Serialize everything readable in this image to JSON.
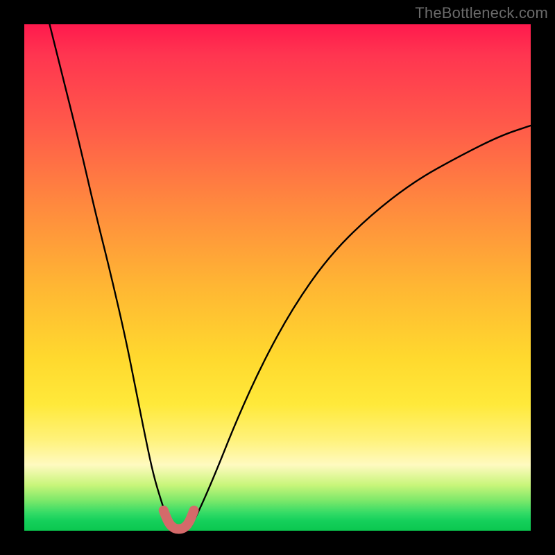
{
  "watermark": "TheBottleneck.com",
  "colors": {
    "frame": "#000000",
    "gradient_top": "#ff1a4d",
    "gradient_mid": "#ffd92e",
    "gradient_bottom": "#0bc74f",
    "curve": "#000000",
    "highlight": "#d46a6a"
  },
  "chart_data": {
    "type": "line",
    "title": "",
    "xlabel": "",
    "ylabel": "",
    "xlim": [
      0,
      100
    ],
    "ylim": [
      0,
      100
    ],
    "grid": false,
    "legend": false,
    "series": [
      {
        "name": "left-branch",
        "x": [
          5,
          8,
          11,
          14,
          17,
          20,
          22,
          24,
          25.5,
          27,
          28,
          29
        ],
        "y": [
          100,
          88,
          76,
          63,
          51,
          38,
          28,
          18,
          11,
          6,
          3,
          1
        ]
      },
      {
        "name": "right-branch",
        "x": [
          33,
          35,
          38,
          42,
          47,
          53,
          60,
          68,
          77,
          86,
          94,
          100
        ],
        "y": [
          1,
          5,
          12,
          22,
          33,
          44,
          54,
          62,
          69,
          74,
          78,
          80
        ]
      },
      {
        "name": "valley-highlight",
        "x": [
          27.5,
          28.5,
          29.5,
          30.5,
          31.5,
          32.5,
          33.5
        ],
        "y": [
          4,
          1.5,
          0.5,
          0.3,
          0.5,
          1.5,
          4
        ]
      }
    ]
  }
}
